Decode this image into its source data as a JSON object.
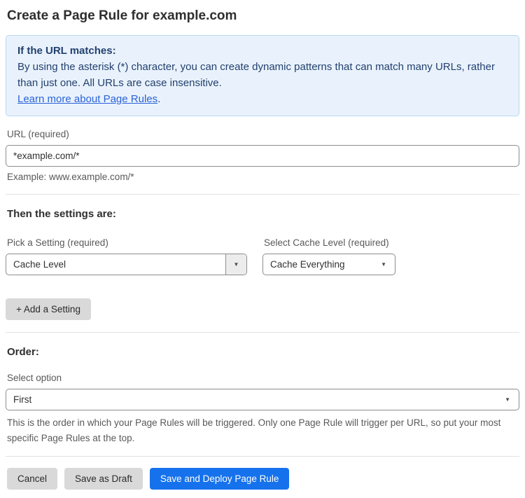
{
  "page": {
    "title": "Create a Page Rule for example.com"
  },
  "info_box": {
    "heading": "If the URL matches:",
    "body": "By using the asterisk (*) character, you can create dynamic patterns that can match many URLs, rather than just one. All URLs are case insensitive.",
    "link": "Learn more about Page Rules",
    "link_suffix": "."
  },
  "url_field": {
    "label": "URL (required)",
    "value": "*example.com/*",
    "example": "Example: www.example.com/*"
  },
  "settings": {
    "heading": "Then the settings are:",
    "setting_label": "Pick a Setting (required)",
    "setting_value": "Cache Level",
    "cache_label": "Select Cache Level (required)",
    "cache_value": "Cache Everything",
    "add_button": "+ Add a Setting"
  },
  "order": {
    "heading": "Order:",
    "label": "Select option",
    "value": "First",
    "help": "This is the order in which your Page Rules will be triggered. Only one Page Rule will trigger per URL, so put your most specific Page Rules at the top."
  },
  "actions": {
    "cancel": "Cancel",
    "save_draft": "Save as Draft",
    "save_deploy": "Save and Deploy Page Rule"
  },
  "icons": {
    "dropdown_arrow": "▼"
  },
  "colors": {
    "info_box_bg": "#e9f2fc",
    "info_box_border": "#b9d7f1",
    "info_text": "#23406e",
    "link_blue": "#2b62d9",
    "primary_button_blue": "#1672ec",
    "gray_button_bg": "#d9d9d9",
    "input_border": "#8d8d8d",
    "divider": "#e2e2e2"
  }
}
